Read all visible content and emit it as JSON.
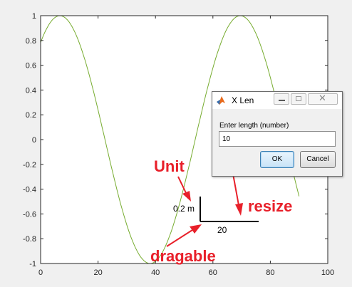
{
  "dialog": {
    "title": "X Len",
    "prompt": "Enter length (number)",
    "input_value": "10",
    "ok_label": "OK",
    "cancel_label": "Cancel"
  },
  "annotations": {
    "unit": "Unit",
    "resize": "resize",
    "dragable": "dragable"
  },
  "scalebar": {
    "vertical_label": "0.2 m",
    "horizontal_label": "20"
  },
  "colors": {
    "curve": "#77ac30",
    "annotation": "#e8202a",
    "axes": "#262626"
  },
  "chart_data": {
    "type": "line",
    "xlim": [
      0,
      100
    ],
    "ylim": [
      -1,
      1
    ],
    "xticks": [
      0,
      20,
      40,
      60,
      80,
      100
    ],
    "yticks": [
      1,
      0.8,
      0.6,
      0.4,
      0.2,
      0,
      -0.2,
      -0.4,
      -0.6,
      -0.8,
      -1
    ],
    "ytick_labels": [
      "1",
      "0.8",
      "0.6",
      "0.4",
      "0.2",
      "0",
      "-0.2",
      "-0.4",
      "-0.6",
      "-0.8",
      "-1"
    ],
    "grid": false,
    "series": [
      {
        "function": "sin(x/10 + 0.9)",
        "x": [
          0,
          5,
          7,
          10,
          15,
          20,
          25,
          30,
          35,
          38.5,
          40,
          45,
          50,
          55,
          60,
          65,
          69.9,
          75,
          80,
          85,
          90
        ],
        "y": [
          0.78,
          0.99,
          1.0,
          0.95,
          0.71,
          0.28,
          -0.2,
          -0.63,
          -0.93,
          -1.0,
          -0.99,
          -0.86,
          -0.53,
          -0.08,
          0.39,
          0.8,
          1.0,
          0.96,
          0.72,
          0.32,
          -0.55
        ]
      }
    ]
  }
}
